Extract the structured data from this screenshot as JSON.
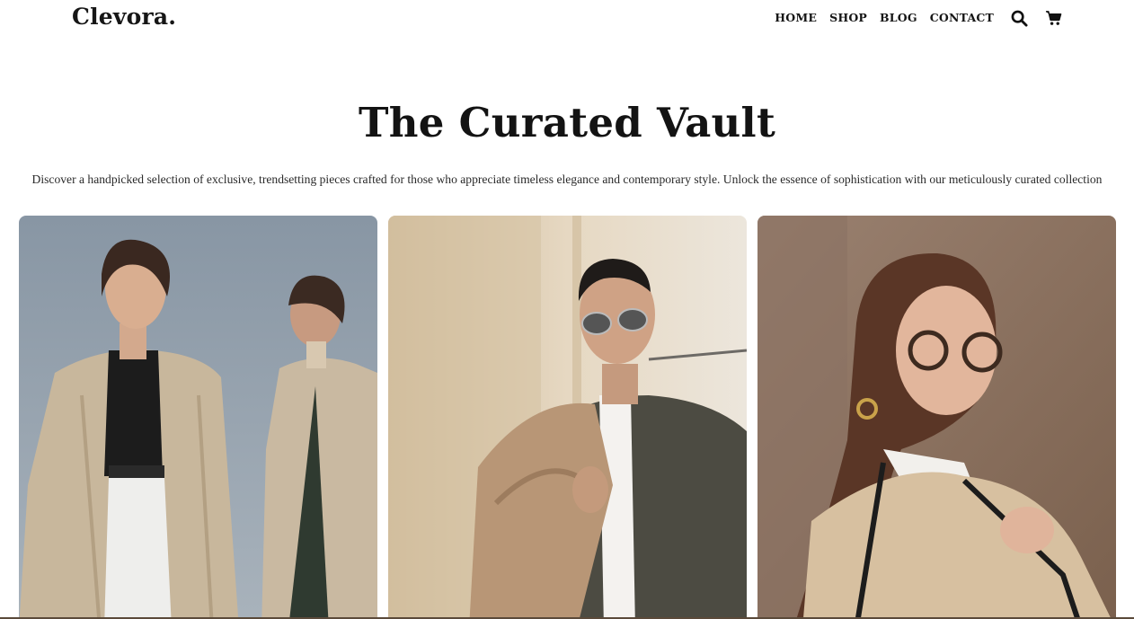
{
  "header": {
    "logo": "Clevora.",
    "nav": [
      "HOME",
      "SHOP",
      "BLOG",
      "CONTACT"
    ],
    "icons": [
      "search-icon",
      "cart-icon"
    ]
  },
  "hero": {
    "title": "The Curated Vault",
    "description": "Discover a handpicked selection of exclusive, trendsetting pieces crafted for those who appreciate timeless elegance and contemporary style. Unlock the essence of sophistication with our meticulously curated collection"
  },
  "colors": {
    "text": "#151515",
    "card1_bg": "#8c9aa6",
    "card2_bg": "#d9c6a8",
    "card3_bg": "#8a6e5a"
  }
}
